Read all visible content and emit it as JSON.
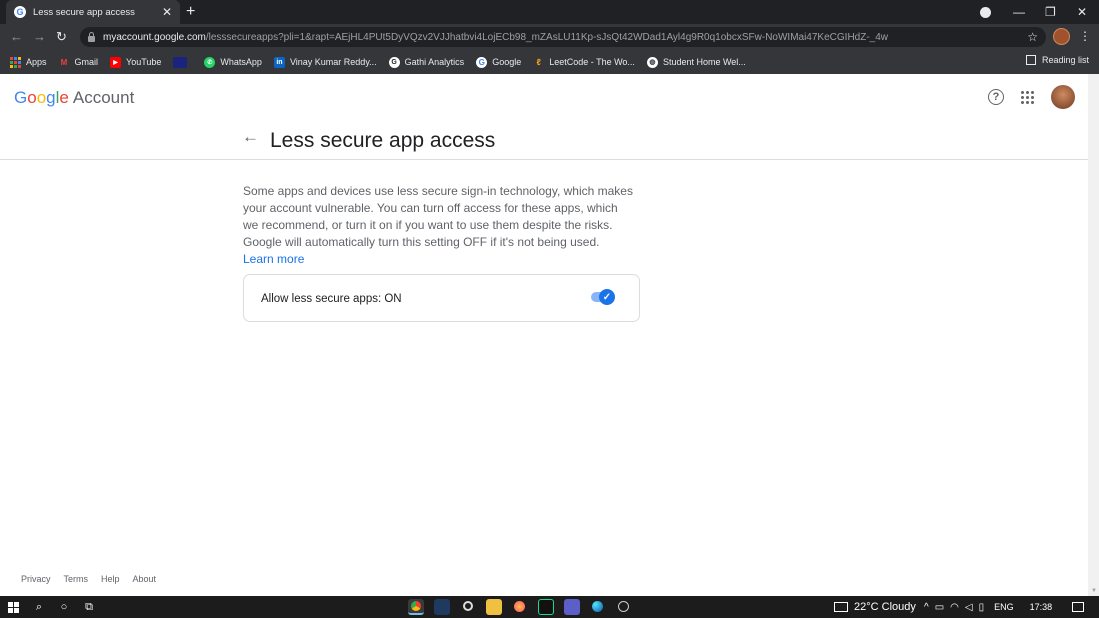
{
  "browser": {
    "tab_title": "Less secure app access",
    "tab_favicon": "G",
    "url_host": "myaccount.google.com",
    "url_path": "/lesssecureapps?pli=1&rapt=AEjHL4PUt5DyVQzv2VJJhatbvi4LojECb98_mZAsLU11Kp-sJsQt42WDad1Ayl4g9R0q1obcxSFw-NoWIMai47KeCGIHdZ-_4w",
    "bookmarks": [
      {
        "label": "Apps",
        "icon": "apps-grid-icon",
        "color": "#ea4335"
      },
      {
        "label": "Gmail",
        "icon": "gmail-icon",
        "color": "#ea4335"
      },
      {
        "label": "YouTube",
        "icon": "youtube-icon",
        "color": "#ff0000"
      },
      {
        "label": "",
        "icon": "blank-bookmark-icon",
        "color": "#1a237e"
      },
      {
        "label": "WhatsApp",
        "icon": "whatsapp-icon",
        "color": "#25d366"
      },
      {
        "label": "Vinay Kumar Reddy...",
        "icon": "linkedin-icon",
        "color": "#0a66c2"
      },
      {
        "label": "Gathi Analytics",
        "icon": "gathi-icon",
        "color": "#ffffff"
      },
      {
        "label": "Google",
        "icon": "google-icon",
        "color": "#ffffff"
      },
      {
        "label": "LeetCode - The Wo...",
        "icon": "leetcode-icon",
        "color": "#ffa116"
      },
      {
        "label": "Student Home Wel...",
        "icon": "globe-icon",
        "color": "#ffffff"
      }
    ],
    "reading_list": "Reading list"
  },
  "header": {
    "logo_letters": [
      "G",
      "o",
      "o",
      "g",
      "l",
      "e"
    ],
    "account_label": "Account"
  },
  "page": {
    "title": "Less secure app access",
    "description": "Some apps and devices use less secure sign-in technology, which makes your account vulnerable. You can turn off access for these apps, which we recommend, or turn it on if you want to use them despite the risks. Google will automatically turn this setting OFF if it's not being used.",
    "learn_more": "Learn more",
    "setting_label": "Allow less secure apps: ON",
    "setting_enabled": true
  },
  "footer": {
    "links": [
      "Privacy",
      "Terms",
      "Help",
      "About"
    ]
  },
  "taskbar": {
    "weather": "22°C  Cloudy",
    "language": "ENG",
    "time": "17:38"
  },
  "colors": {
    "accent": "#1a73e8",
    "toggle_track": "#8ab4f8"
  }
}
